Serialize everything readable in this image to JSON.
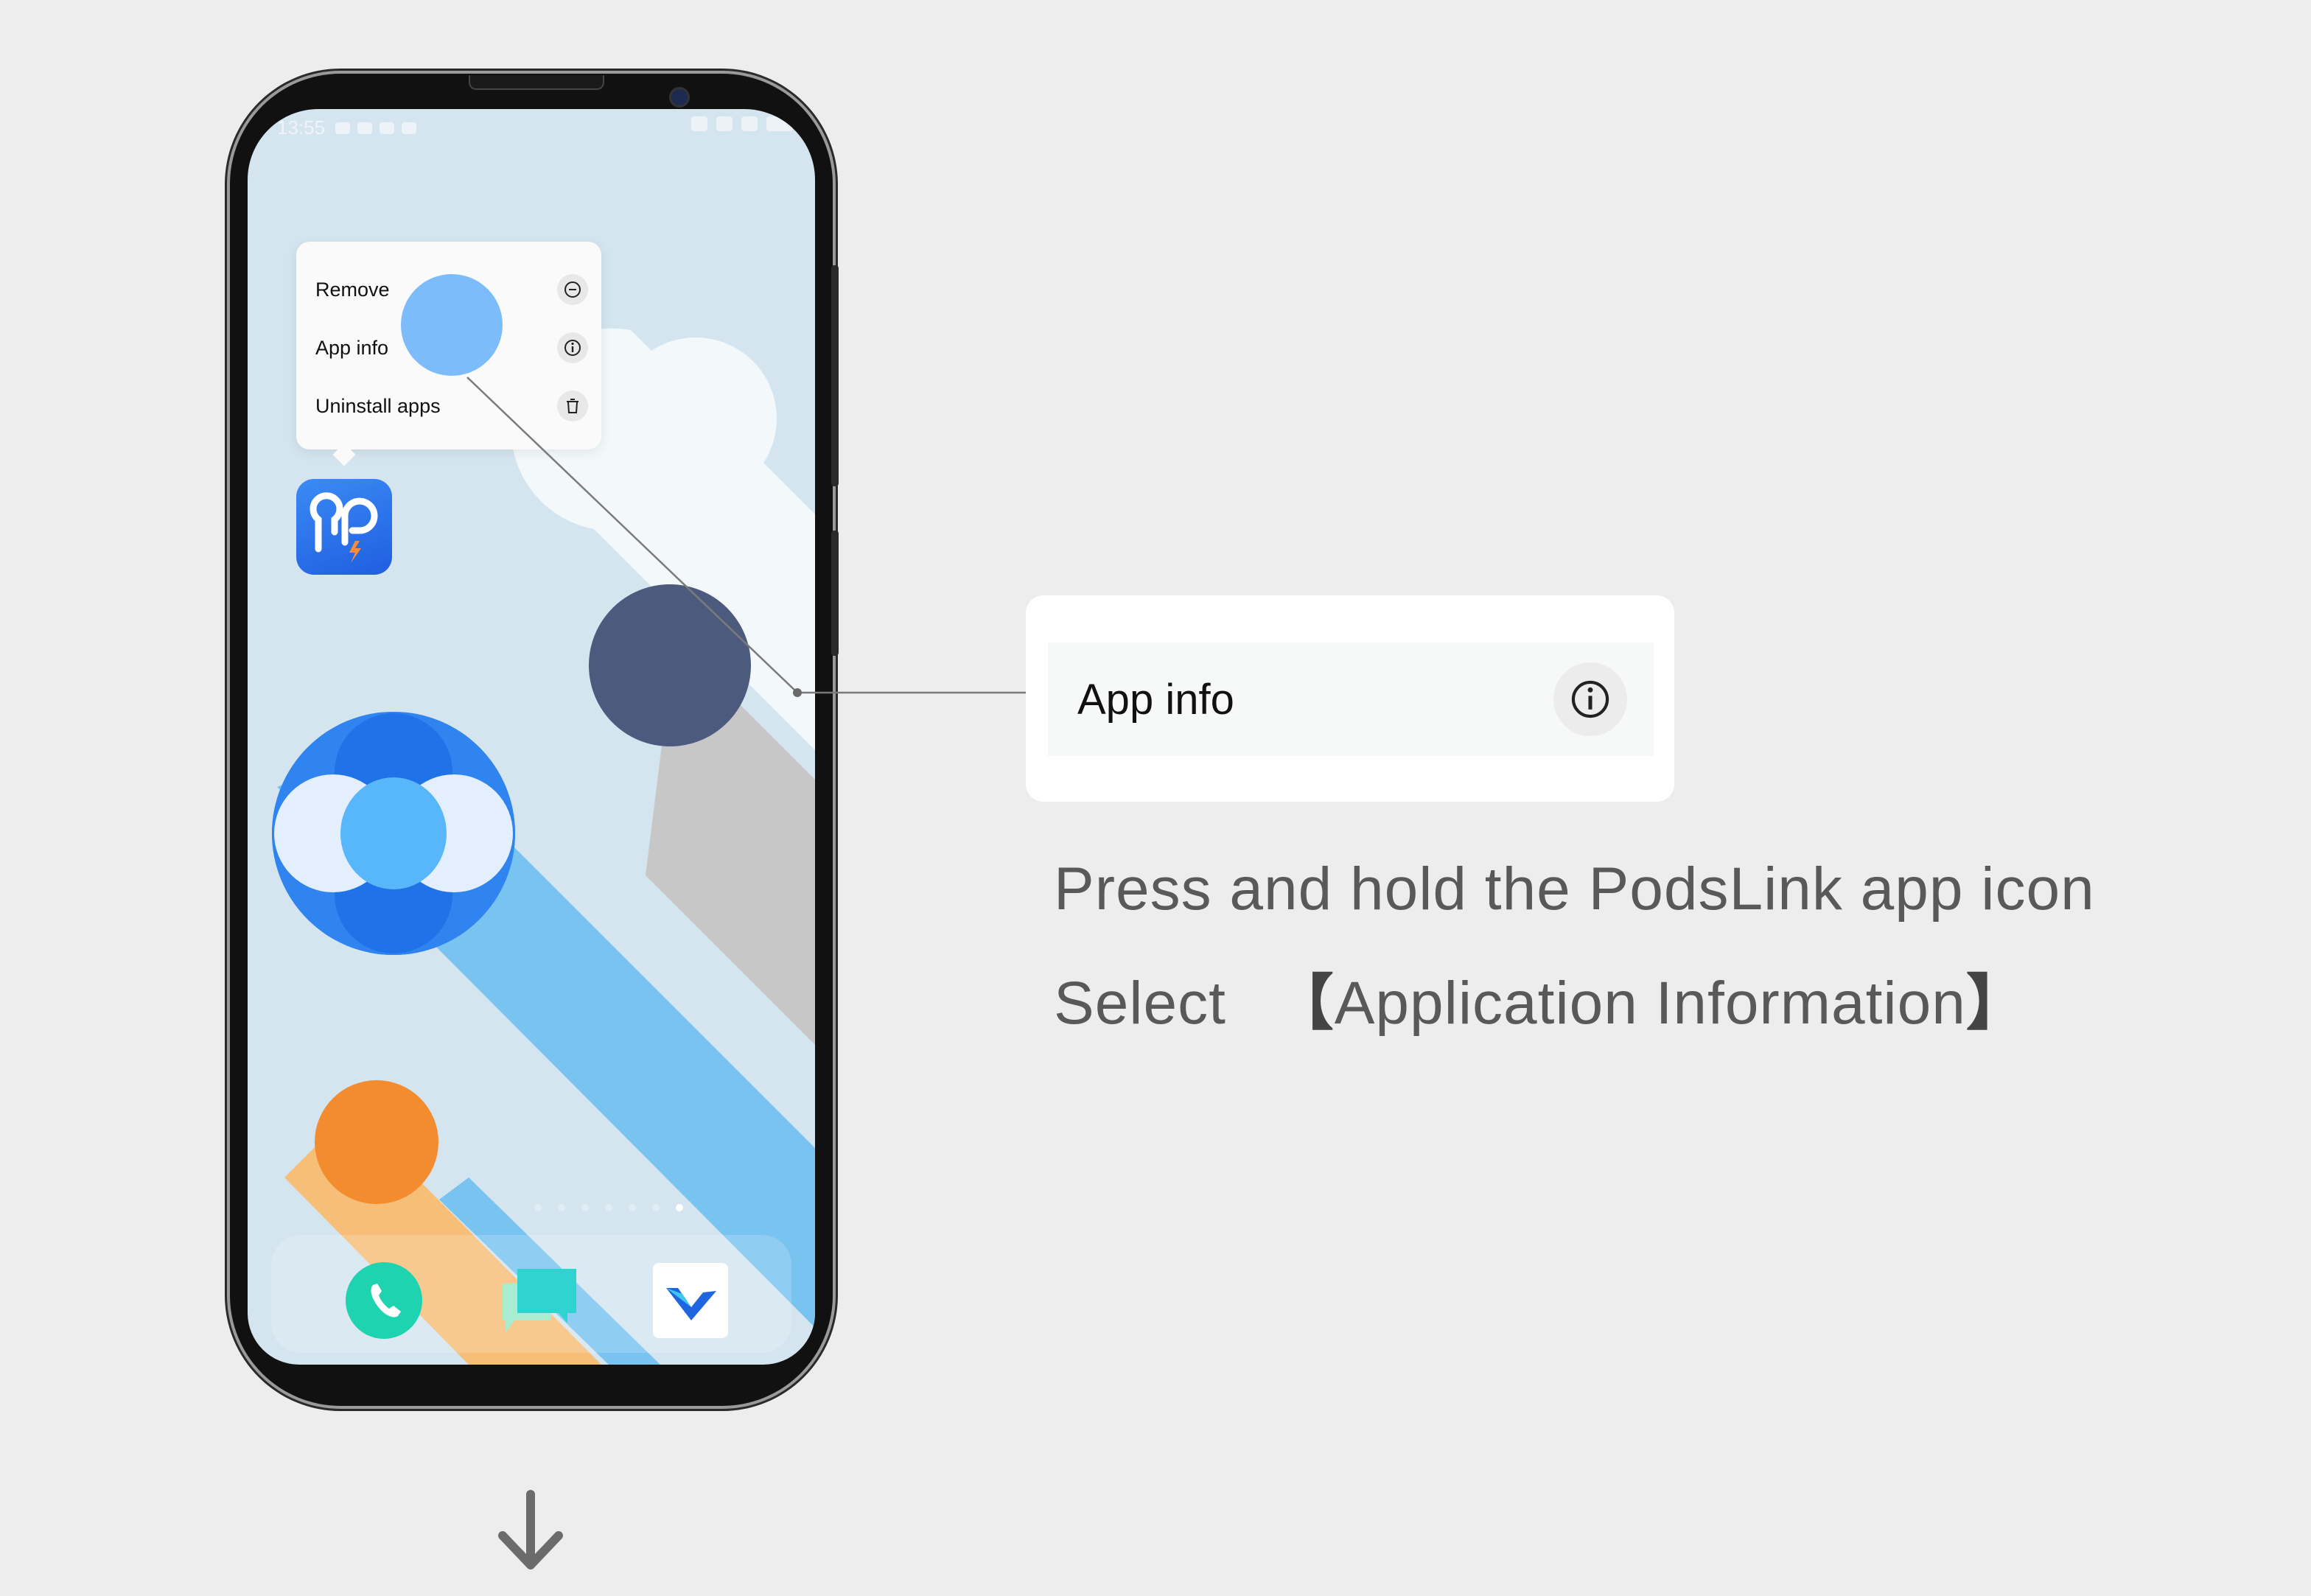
{
  "statusbar": {
    "time": "13:55"
  },
  "context_menu": {
    "items": [
      {
        "label": "Remove",
        "icon": "minus-circle-icon"
      },
      {
        "label": "App info",
        "icon": "info-icon"
      },
      {
        "label": "Uninstall apps",
        "icon": "trash-icon"
      }
    ]
  },
  "app": {
    "name": "PodsLink",
    "icon": "podslink-app-icon"
  },
  "dock": {
    "apps": [
      "phone-icon",
      "messages-icon",
      "browser-icon"
    ]
  },
  "callout": {
    "label": "App info",
    "icon": "info-icon"
  },
  "instructions": {
    "line1": "Press and hold the PodsLink app icon",
    "line2_prefix": "Select",
    "line2_open": "【",
    "line2_item": "Application Information",
    "line2_close": "】"
  },
  "colors": {
    "background": "#ededed",
    "wallpaper": "#d4e5ef",
    "accent_blue": "#7cbcfb",
    "dark_circle": "#4c5b7d",
    "orange": "#f28c2e"
  }
}
